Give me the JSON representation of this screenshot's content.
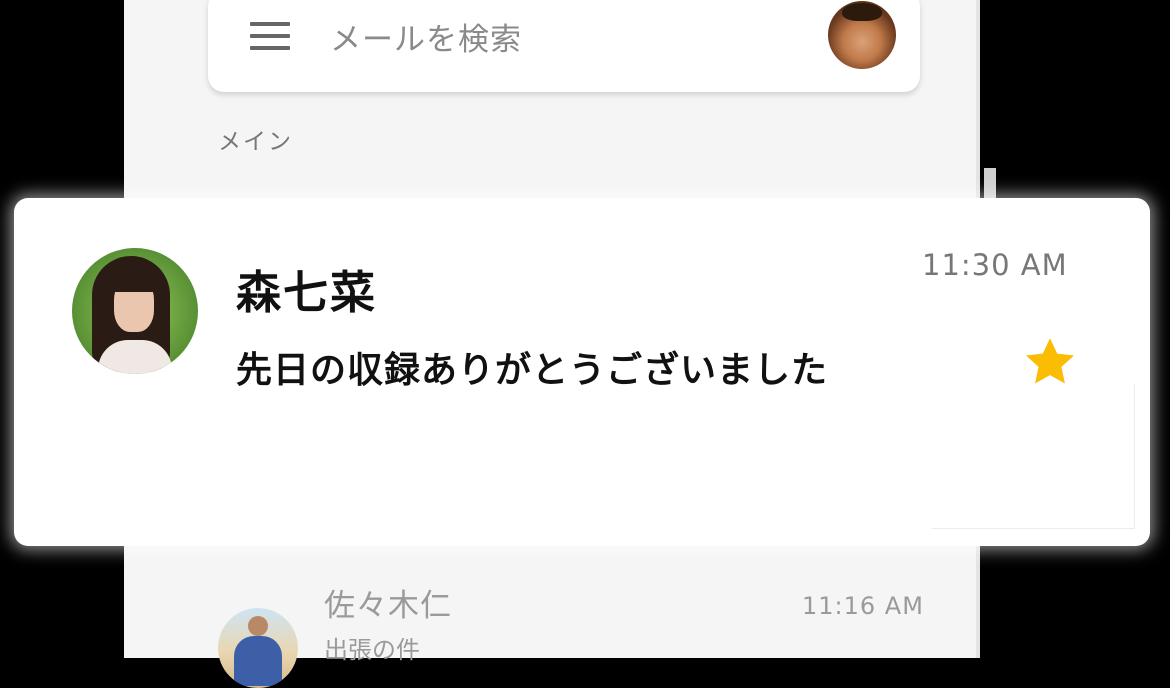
{
  "search": {
    "placeholder": "メールを検索",
    "menu_icon": "hamburger-menu-icon",
    "account_avatar_icon": "account-avatar"
  },
  "inbox": {
    "section_label": "メイン"
  },
  "highlighted_mail": {
    "sender": "森七菜",
    "subject": "先日の収録ありがとうございました",
    "time": "11:30 AM",
    "starred": true,
    "star_color": "#fbbc04"
  },
  "next_mail": {
    "sender": "佐々木仁",
    "subject": "出張の件",
    "time": "11:16 AM"
  }
}
